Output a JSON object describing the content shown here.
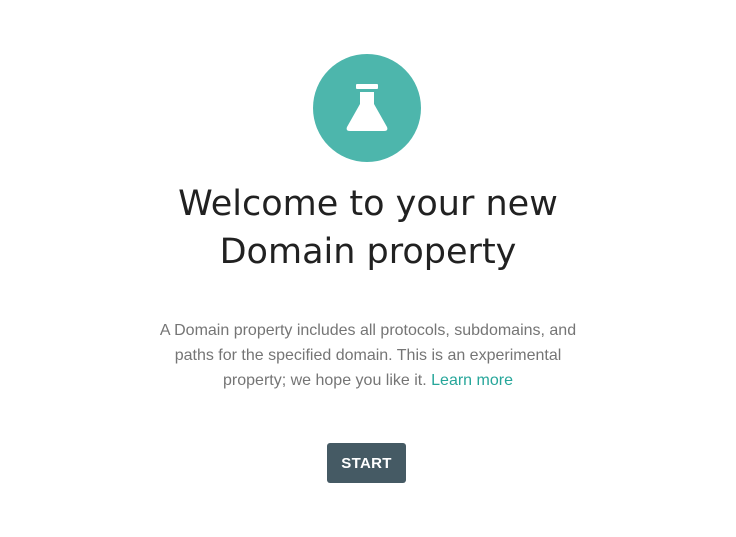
{
  "hero": {
    "icon": "flask-icon",
    "circle_color": "#4db6ac"
  },
  "title": {
    "line1": "Welcome to your new",
    "line2": "Domain property"
  },
  "description": {
    "line1": "A Domain property includes all protocols, subdomains, and",
    "line2": "paths for the specified domain. This is an experimental",
    "line3": "property; we hope you like it.",
    "link_label": "Learn more",
    "link_color": "#26a69a"
  },
  "actions": {
    "start_label": "START",
    "button_color": "#455a64"
  }
}
